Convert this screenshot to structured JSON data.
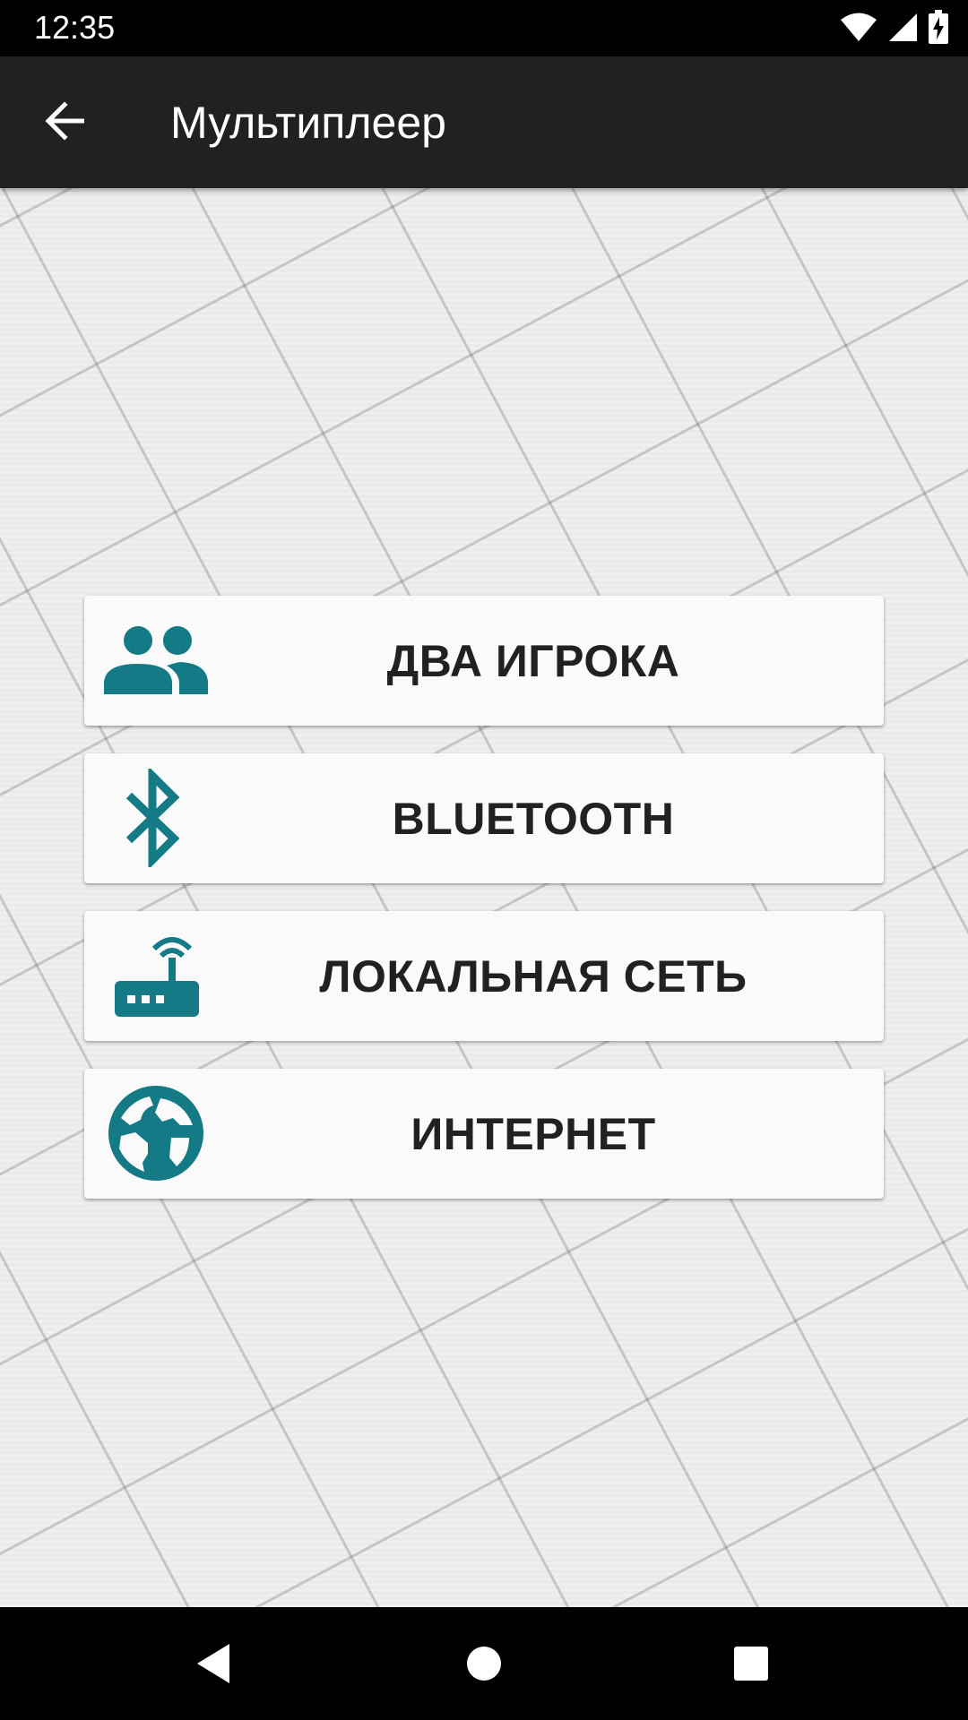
{
  "status_bar": {
    "time": "12:35",
    "icons": [
      "wifi-icon",
      "cell-signal-icon",
      "battery-charging-icon"
    ]
  },
  "app_bar": {
    "title": "Мультиплеер",
    "back_icon": "arrow-back-icon",
    "background_color": "#212121"
  },
  "menu": {
    "accent_color": "#137a86",
    "items": [
      {
        "label": "ДВА ИГРОКА",
        "icon": "two-players-icon"
      },
      {
        "label": "BLUETOOTH",
        "icon": "bluetooth-icon"
      },
      {
        "label": "ЛОКАЛЬНАЯ СЕТЬ",
        "icon": "router-icon"
      },
      {
        "label": "ИНТЕРНЕТ",
        "icon": "globe-icon"
      }
    ]
  },
  "nav_bar": {
    "icons": [
      "back-triangle-icon",
      "home-circle-icon",
      "recents-square-icon"
    ]
  }
}
